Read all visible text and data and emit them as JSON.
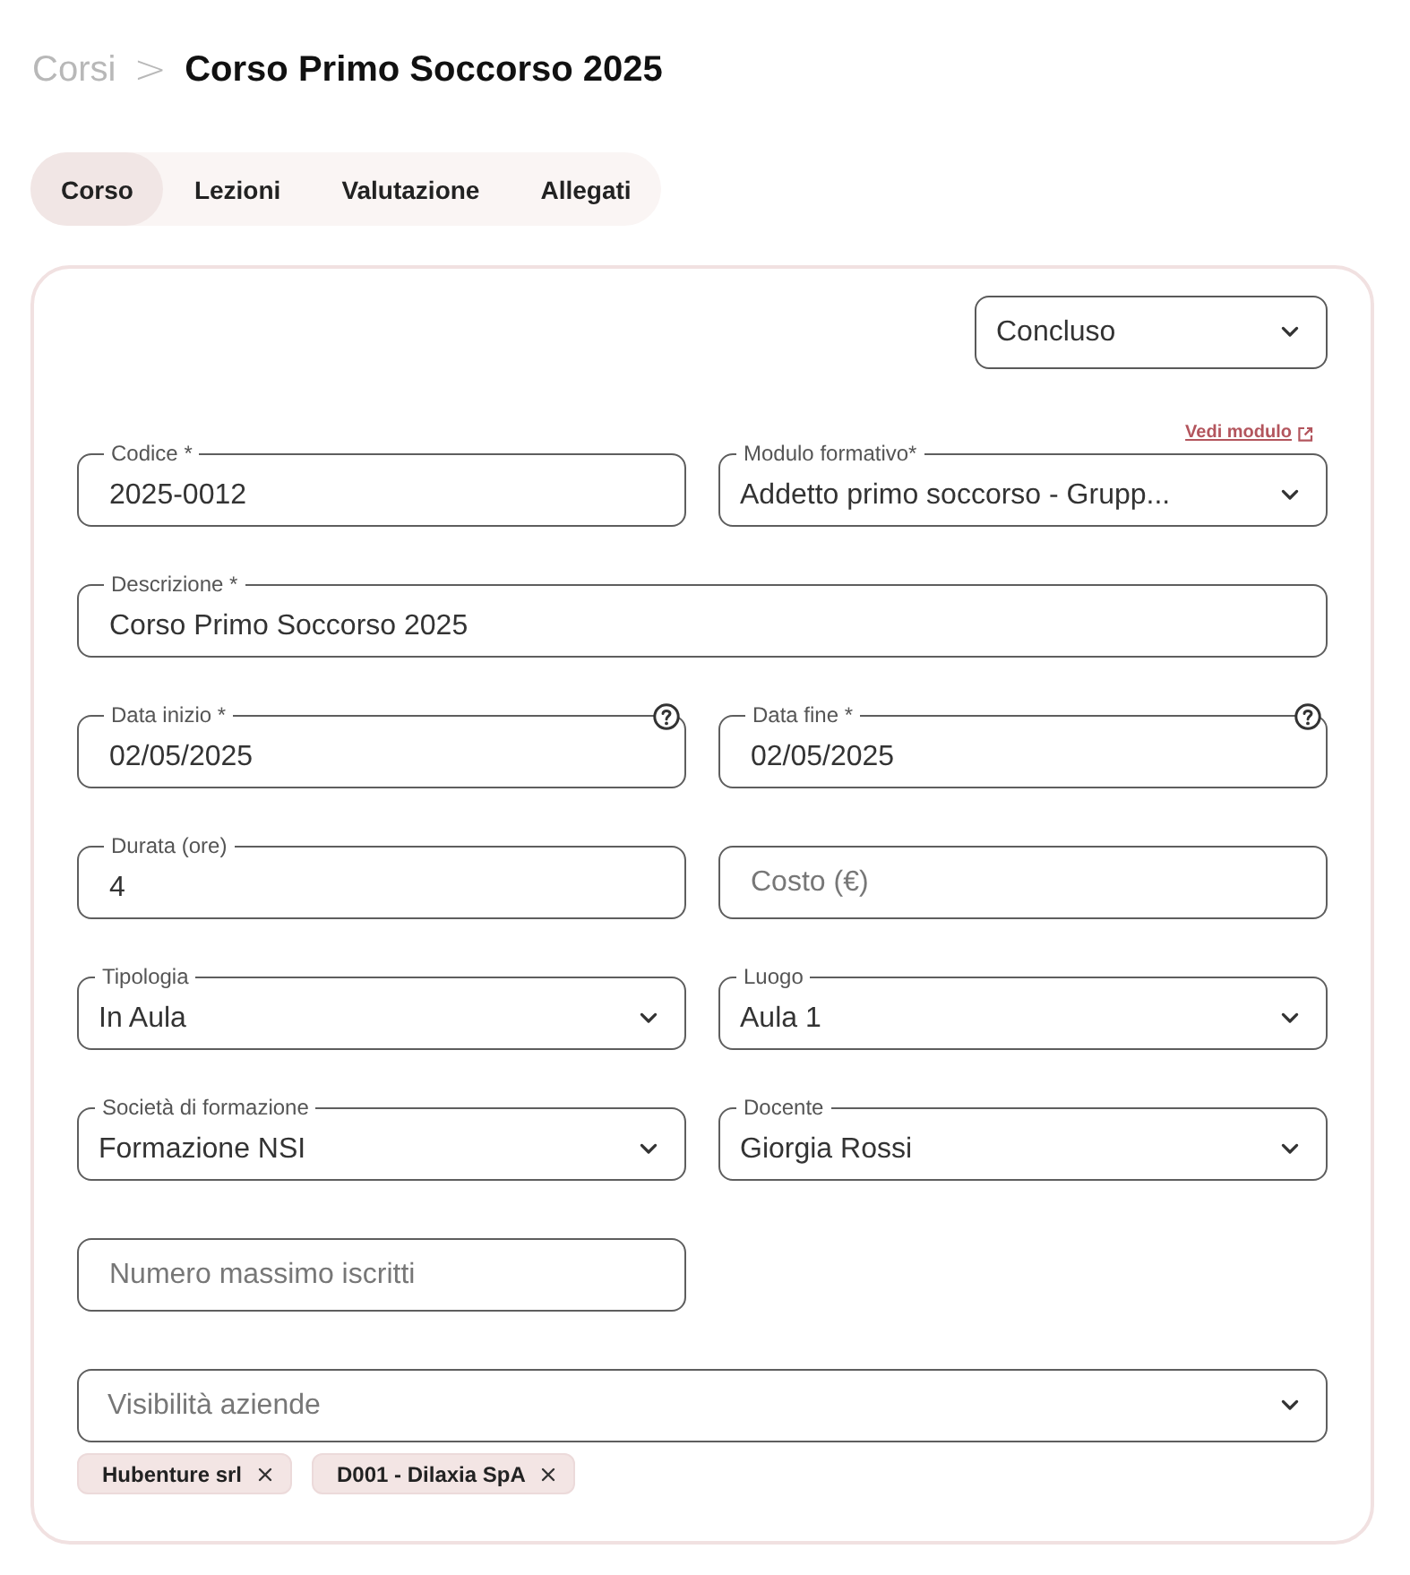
{
  "breadcrumb": {
    "parent": "Corsi",
    "separator": ">",
    "current": "Corso Primo Soccorso 2025"
  },
  "tabs": [
    {
      "label": "Corso",
      "selected": true
    },
    {
      "label": "Lezioni",
      "selected": false
    },
    {
      "label": "Valutazione",
      "selected": false
    },
    {
      "label": "Allegati",
      "selected": false
    }
  ],
  "status_select": {
    "value": "Concluso"
  },
  "module_link": {
    "label": "Vedi modulo"
  },
  "fields": [
    {
      "kind": "text",
      "label": "Codice *",
      "value": "2025-0012",
      "wide": false
    },
    {
      "kind": "select",
      "label": "Modulo formativo*",
      "value": "Addetto primo soccorso - Grupp...",
      "wide": false
    },
    {
      "kind": "text",
      "label": "Descrizione *",
      "value": "Corso Primo Soccorso 2025",
      "wide": true
    },
    {
      "kind": "date",
      "label": "Data inizio *",
      "value": "02/05/2025",
      "wide": false
    },
    {
      "kind": "date",
      "label": "Data fine *",
      "value": "02/05/2025",
      "wide": false
    },
    {
      "kind": "text",
      "label": "Durata (ore)",
      "value": "4",
      "wide": false
    },
    {
      "kind": "text",
      "placeholder": "Costo (€)",
      "wide": false
    },
    {
      "kind": "select",
      "label": "Tipologia",
      "value": "In Aula",
      "wide": false
    },
    {
      "kind": "select",
      "label": "Luogo",
      "value": "Aula 1",
      "wide": false
    },
    {
      "kind": "select",
      "label": "Società di formazione",
      "value": "Formazione NSI",
      "wide": false
    },
    {
      "kind": "select",
      "label": "Docente",
      "value": "Giorgia Rossi",
      "wide": false
    },
    {
      "kind": "text",
      "placeholder": "Numero massimo iscritti",
      "wide": false
    },
    {
      "kind": "select",
      "placeholder": "Visibilità aziende",
      "wide": true,
      "tags": [
        {
          "label": "Hubenture srl"
        },
        {
          "label": "D001 - Dilaxia SpA"
        }
      ]
    }
  ]
}
